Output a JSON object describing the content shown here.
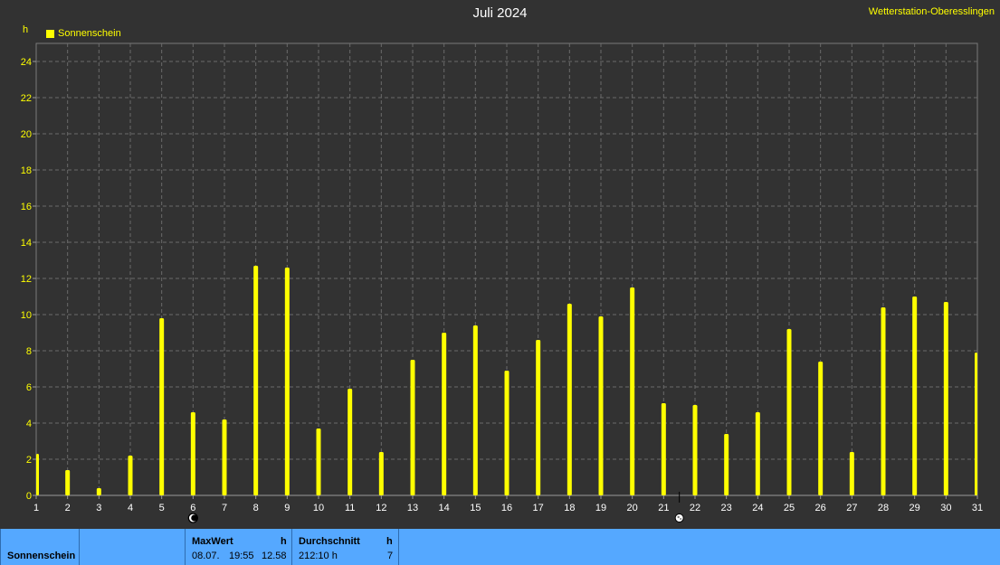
{
  "header": {
    "title": "Juli 2024",
    "station": "Wetterstation-Oberesslingen",
    "unit": "h",
    "legend": "Sonnenschein"
  },
  "footer": {
    "name": "Sonnenschein",
    "max_label": "MaxWert",
    "max_unit": "h",
    "max_date": "08.07.",
    "max_time": "19:55",
    "max_value": "12.58",
    "avg_label": "Durchschnitt",
    "avg_unit": "h",
    "avg_sum": "212:10 h",
    "avg_value": "7"
  },
  "colors": {
    "background": "#323232",
    "bars": "#ffff00",
    "grid": "#6a6a6a",
    "footer": "#55a8ff"
  },
  "chart_data": {
    "type": "bar",
    "categories": [
      "1",
      "2",
      "3",
      "4",
      "5",
      "6",
      "7",
      "8",
      "9",
      "10",
      "11",
      "12",
      "13",
      "14",
      "15",
      "16",
      "17",
      "18",
      "19",
      "20",
      "21",
      "22",
      "23",
      "24",
      "25",
      "26",
      "27",
      "28",
      "29",
      "30",
      "31"
    ],
    "series": [
      {
        "name": "Sonnenschein",
        "values": [
          2.3,
          1.4,
          0.4,
          2.2,
          9.8,
          4.6,
          4.2,
          12.7,
          12.6,
          3.7,
          5.9,
          2.4,
          7.5,
          9.0,
          9.4,
          6.9,
          8.6,
          10.6,
          9.9,
          11.5,
          5.1,
          5.0,
          3.4,
          4.6,
          9.2,
          7.4,
          2.4,
          10.4,
          11.0,
          10.7,
          7.9
        ]
      }
    ],
    "ylabel": "h",
    "yticks": [
      0,
      2,
      4,
      6,
      8,
      10,
      12,
      14,
      16,
      18,
      20,
      22,
      24
    ],
    "ylim": [
      0,
      25
    ],
    "xlim": [
      1,
      31
    ],
    "grid": true,
    "legend_position": "top-left",
    "moon_phases": [
      {
        "day": 6,
        "phase": "new-moon"
      },
      {
        "day": 21.5,
        "phase": "full-moon"
      }
    ]
  }
}
